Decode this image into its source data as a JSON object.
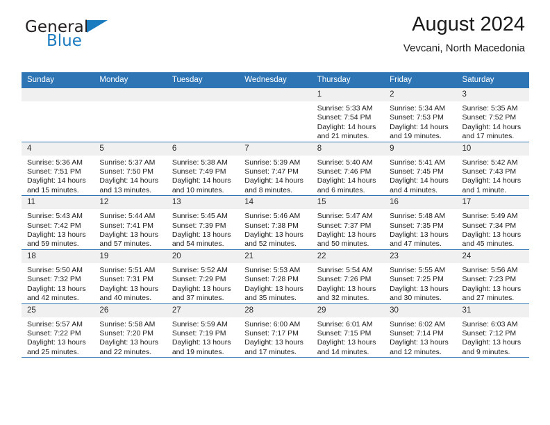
{
  "brand": {
    "name_part1": "General",
    "name_part2": "Blue",
    "triangle_color": "#1b7bbf"
  },
  "header": {
    "title": "August 2024",
    "subtitle": "Vevcani, North Macedonia"
  },
  "colors": {
    "header_blue": "#2e75b6",
    "daynum_band": "#f0f0f0",
    "text": "#1c1c1c"
  },
  "calendar": {
    "weekday_headers": [
      "Sunday",
      "Monday",
      "Tuesday",
      "Wednesday",
      "Thursday",
      "Friday",
      "Saturday"
    ],
    "weeks": [
      [
        {
          "day": "",
          "lines": []
        },
        {
          "day": "",
          "lines": []
        },
        {
          "day": "",
          "lines": []
        },
        {
          "day": "",
          "lines": []
        },
        {
          "day": "1",
          "lines": [
            "Sunrise: 5:33 AM",
            "Sunset: 7:54 PM",
            "Daylight: 14 hours",
            "and 21 minutes."
          ]
        },
        {
          "day": "2",
          "lines": [
            "Sunrise: 5:34 AM",
            "Sunset: 7:53 PM",
            "Daylight: 14 hours",
            "and 19 minutes."
          ]
        },
        {
          "day": "3",
          "lines": [
            "Sunrise: 5:35 AM",
            "Sunset: 7:52 PM",
            "Daylight: 14 hours",
            "and 17 minutes."
          ]
        }
      ],
      [
        {
          "day": "4",
          "lines": [
            "Sunrise: 5:36 AM",
            "Sunset: 7:51 PM",
            "Daylight: 14 hours",
            "and 15 minutes."
          ]
        },
        {
          "day": "5",
          "lines": [
            "Sunrise: 5:37 AM",
            "Sunset: 7:50 PM",
            "Daylight: 14 hours",
            "and 13 minutes."
          ]
        },
        {
          "day": "6",
          "lines": [
            "Sunrise: 5:38 AM",
            "Sunset: 7:49 PM",
            "Daylight: 14 hours",
            "and 10 minutes."
          ]
        },
        {
          "day": "7",
          "lines": [
            "Sunrise: 5:39 AM",
            "Sunset: 7:47 PM",
            "Daylight: 14 hours",
            "and 8 minutes."
          ]
        },
        {
          "day": "8",
          "lines": [
            "Sunrise: 5:40 AM",
            "Sunset: 7:46 PM",
            "Daylight: 14 hours",
            "and 6 minutes."
          ]
        },
        {
          "day": "9",
          "lines": [
            "Sunrise: 5:41 AM",
            "Sunset: 7:45 PM",
            "Daylight: 14 hours",
            "and 4 minutes."
          ]
        },
        {
          "day": "10",
          "lines": [
            "Sunrise: 5:42 AM",
            "Sunset: 7:43 PM",
            "Daylight: 14 hours",
            "and 1 minute."
          ]
        }
      ],
      [
        {
          "day": "11",
          "lines": [
            "Sunrise: 5:43 AM",
            "Sunset: 7:42 PM",
            "Daylight: 13 hours",
            "and 59 minutes."
          ]
        },
        {
          "day": "12",
          "lines": [
            "Sunrise: 5:44 AM",
            "Sunset: 7:41 PM",
            "Daylight: 13 hours",
            "and 57 minutes."
          ]
        },
        {
          "day": "13",
          "lines": [
            "Sunrise: 5:45 AM",
            "Sunset: 7:39 PM",
            "Daylight: 13 hours",
            "and 54 minutes."
          ]
        },
        {
          "day": "14",
          "lines": [
            "Sunrise: 5:46 AM",
            "Sunset: 7:38 PM",
            "Daylight: 13 hours",
            "and 52 minutes."
          ]
        },
        {
          "day": "15",
          "lines": [
            "Sunrise: 5:47 AM",
            "Sunset: 7:37 PM",
            "Daylight: 13 hours",
            "and 50 minutes."
          ]
        },
        {
          "day": "16",
          "lines": [
            "Sunrise: 5:48 AM",
            "Sunset: 7:35 PM",
            "Daylight: 13 hours",
            "and 47 minutes."
          ]
        },
        {
          "day": "17",
          "lines": [
            "Sunrise: 5:49 AM",
            "Sunset: 7:34 PM",
            "Daylight: 13 hours",
            "and 45 minutes."
          ]
        }
      ],
      [
        {
          "day": "18",
          "lines": [
            "Sunrise: 5:50 AM",
            "Sunset: 7:32 PM",
            "Daylight: 13 hours",
            "and 42 minutes."
          ]
        },
        {
          "day": "19",
          "lines": [
            "Sunrise: 5:51 AM",
            "Sunset: 7:31 PM",
            "Daylight: 13 hours",
            "and 40 minutes."
          ]
        },
        {
          "day": "20",
          "lines": [
            "Sunrise: 5:52 AM",
            "Sunset: 7:29 PM",
            "Daylight: 13 hours",
            "and 37 minutes."
          ]
        },
        {
          "day": "21",
          "lines": [
            "Sunrise: 5:53 AM",
            "Sunset: 7:28 PM",
            "Daylight: 13 hours",
            "and 35 minutes."
          ]
        },
        {
          "day": "22",
          "lines": [
            "Sunrise: 5:54 AM",
            "Sunset: 7:26 PM",
            "Daylight: 13 hours",
            "and 32 minutes."
          ]
        },
        {
          "day": "23",
          "lines": [
            "Sunrise: 5:55 AM",
            "Sunset: 7:25 PM",
            "Daylight: 13 hours",
            "and 30 minutes."
          ]
        },
        {
          "day": "24",
          "lines": [
            "Sunrise: 5:56 AM",
            "Sunset: 7:23 PM",
            "Daylight: 13 hours",
            "and 27 minutes."
          ]
        }
      ],
      [
        {
          "day": "25",
          "lines": [
            "Sunrise: 5:57 AM",
            "Sunset: 7:22 PM",
            "Daylight: 13 hours",
            "and 25 minutes."
          ]
        },
        {
          "day": "26",
          "lines": [
            "Sunrise: 5:58 AM",
            "Sunset: 7:20 PM",
            "Daylight: 13 hours",
            "and 22 minutes."
          ]
        },
        {
          "day": "27",
          "lines": [
            "Sunrise: 5:59 AM",
            "Sunset: 7:19 PM",
            "Daylight: 13 hours",
            "and 19 minutes."
          ]
        },
        {
          "day": "28",
          "lines": [
            "Sunrise: 6:00 AM",
            "Sunset: 7:17 PM",
            "Daylight: 13 hours",
            "and 17 minutes."
          ]
        },
        {
          "day": "29",
          "lines": [
            "Sunrise: 6:01 AM",
            "Sunset: 7:15 PM",
            "Daylight: 13 hours",
            "and 14 minutes."
          ]
        },
        {
          "day": "30",
          "lines": [
            "Sunrise: 6:02 AM",
            "Sunset: 7:14 PM",
            "Daylight: 13 hours",
            "and 12 minutes."
          ]
        },
        {
          "day": "31",
          "lines": [
            "Sunrise: 6:03 AM",
            "Sunset: 7:12 PM",
            "Daylight: 13 hours",
            "and 9 minutes."
          ]
        }
      ]
    ]
  }
}
